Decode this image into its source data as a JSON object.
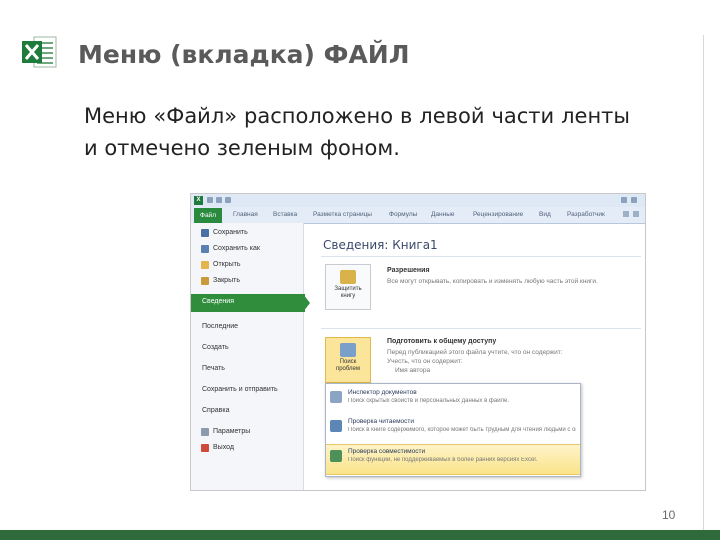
{
  "slide": {
    "title": "Меню  (вкладка) ФАЙЛ",
    "body": "Меню «Файл» расположено в левой части ленты и отмечено зеленым фоном.",
    "page_number": "10",
    "accent_color": "#2f6b3a"
  },
  "screenshot": {
    "ribbon_tabs": [
      "Файл",
      "Главная",
      "Вставка",
      "Разметка страницы",
      "Формулы",
      "Данные",
      "Рецензирование",
      "Вид",
      "Разработчик"
    ],
    "file_menu": {
      "items": [
        "Сохранить",
        "Сохранить как",
        "Открыть",
        "Закрыть",
        "Сведения",
        "Последние",
        "Создать",
        "Печать",
        "Сохранить и отправить",
        "Справка",
        "Параметры",
        "Выход"
      ],
      "selected": "Сведения",
      "selected_color": "#2f8d3c"
    },
    "pane_title": "Сведения: Книга1",
    "permissions": {
      "button_label_1": "Защитить",
      "button_label_2": "книгу",
      "title": "Разрешения",
      "desc": "Все могут открывать, копировать и изменять любую часть этой книги."
    },
    "prepare": {
      "button_label_1": "Поиск",
      "button_label_2": "проблем",
      "title": "Подготовить к общему доступу",
      "desc_1": "Перед публикацией этого файла учтите, что он содержит:",
      "desc_2": "Учесть, что он содержит:",
      "bullet": "Имя автора"
    },
    "dropdown": [
      {
        "title": "Инспектор документов",
        "desc": "Поиск скрытых свойств и персональных данных в файле."
      },
      {
        "title": "Проверка читаемости",
        "desc": "Поиск в книге содержимого, которое может быть трудным для чтения людьми с ограниченными возможностями."
      },
      {
        "title": "Проверка совместимости",
        "desc": "Поиск функций, не поддерживаемых в более ранних версиях Excel."
      }
    ]
  }
}
